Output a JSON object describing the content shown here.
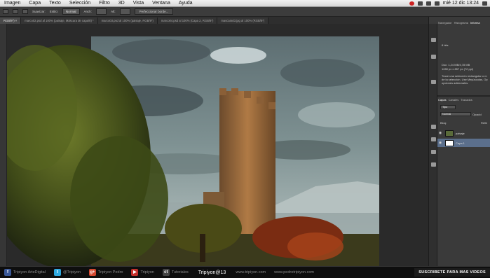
{
  "menubar": {
    "items": [
      "Imagen",
      "Capa",
      "Texto",
      "Selección",
      "Filtro",
      "3D",
      "Vista",
      "Ventana",
      "Ayuda"
    ],
    "clock": "mié 12 dic  13:24"
  },
  "options": {
    "suavizar": "Suavizar:",
    "estilo_label": "Estilo:",
    "estilo_value": "Normal",
    "anch": "Anch:",
    "alt": "Alt:",
    "refine_button": "Perfeccionar borde..."
  },
  "tabs": [
    "RGB/8*) ×",
    "marco02.psd al 100% (paisaje, Máscara de capa/8) *",
    "marco03.psd al 100% (paisaje, RGB/8*)",
    "marco04.psd al 100% (Capa 2, RGB/8*)",
    "mascara03.jpg al 100% (RGB/8*)"
  ],
  "panels": {
    "top_tabs": [
      "Navegador",
      "Histograma",
      "Informa"
    ],
    "bits": "8 bits",
    "doc_info": "Doc: 1,24 MB/4,78 MB",
    "dims": "1280 px x 857 px (72 ppi)",
    "hint_lines": [
      "Trace una selección rectangular o m",
      "de la selección. Use Mayúsculas, Op",
      "opciones adicionales."
    ],
    "layer_tabs": [
      "Capas",
      "Canales",
      "Trazados"
    ],
    "kind_label": "Tipo",
    "blend_mode": "Normal",
    "opacity_label": "Opacid",
    "lock_label": "Bloq:",
    "fill_label": "Relle",
    "layers": [
      {
        "name": "paisaje",
        "selected": false
      },
      {
        "name": "Capa 1",
        "selected": true
      }
    ]
  },
  "bottombar": {
    "items": [
      {
        "icon": "f",
        "label": "Tripiyon ArteDigital",
        "color": "#3b5998"
      },
      {
        "icon": "t",
        "label": "@Tripiyon",
        "color": "#2fa9e0"
      },
      {
        "icon": "g+",
        "label": "Tripiyon Pedro",
        "color": "#d3472f"
      },
      {
        "icon": "▶",
        "label": "Tripiyon",
        "color": "#c4302b"
      },
      {
        "icon": "ct",
        "label": "Tutoriales",
        "color": "#444444"
      }
    ],
    "brand": "Tripiyon@13",
    "site1": "www.tripiyon.com",
    "site2": "www.pedrotripiyon.com",
    "subscribe": "SUSCRIBETE PARA MAS VIDEOS"
  }
}
